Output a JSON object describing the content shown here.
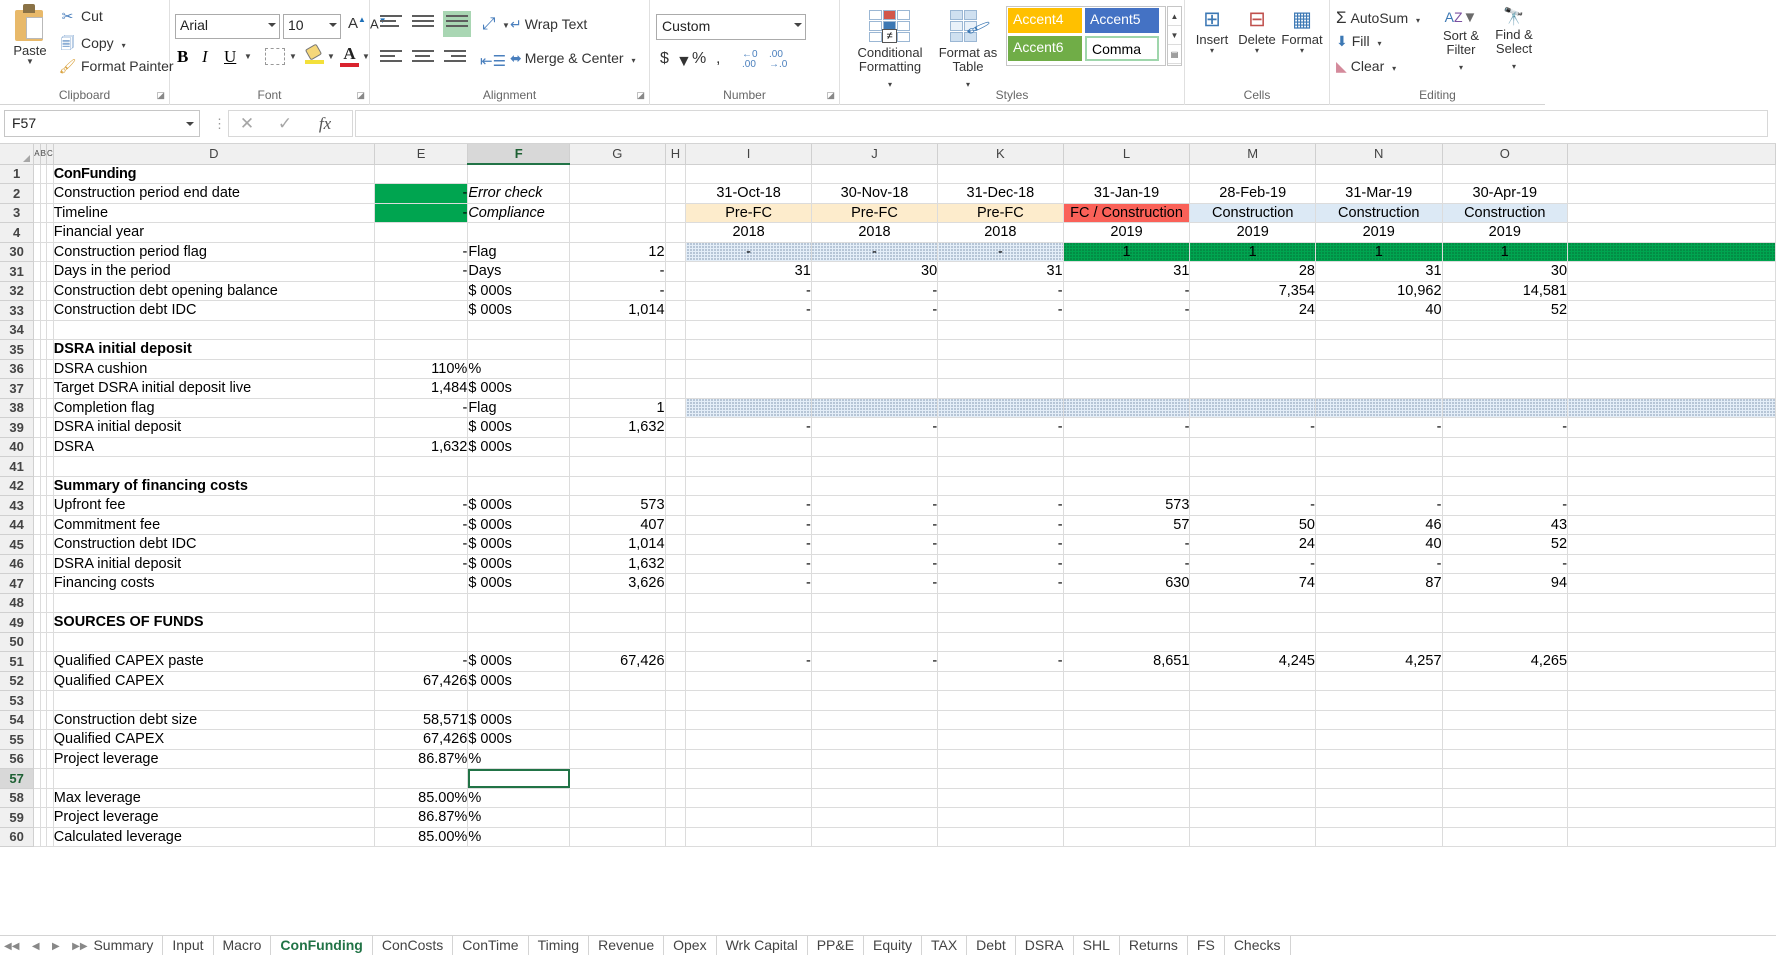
{
  "ribbon": {
    "clipboard": {
      "label": "Clipboard",
      "paste": "Paste",
      "cut": "Cut",
      "copy": "Copy",
      "format_painter": "Format Painter"
    },
    "font": {
      "label": "Font",
      "font_name": "Arial",
      "font_size": "10",
      "grow_font": "A",
      "shrink_font": "A",
      "bold": "B",
      "italic": "I",
      "underline": "U",
      "font_color_letter": "A"
    },
    "alignment": {
      "label": "Alignment",
      "wrap_text": "Wrap Text",
      "merge_center": "Merge & Center"
    },
    "number": {
      "label": "Number",
      "format": "Custom",
      "currency": "$",
      "percent": "%",
      "comma": ",",
      "inc_dec": ".00",
      "dec_dec": ".0"
    },
    "styles": {
      "label": "Styles",
      "conditional_formatting": "Conditional Formatting",
      "format_as_table": "Format as Table",
      "gallery": [
        {
          "name": "Accent4",
          "bg": "#ffc000",
          "fg": "#ffffff"
        },
        {
          "name": "Accent5",
          "bg": "#4472c4",
          "fg": "#ffffff"
        },
        {
          "name": "Accent6",
          "bg": "#70ad47",
          "fg": "#ffffff"
        },
        {
          "name": "Comma",
          "bg": "#ffffff",
          "fg": "#000000"
        }
      ]
    },
    "cells": {
      "label": "Cells",
      "insert": "Insert",
      "delete": "Delete",
      "format": "Format"
    },
    "editing": {
      "label": "Editing",
      "autosum": "AutoSum",
      "fill": "Fill",
      "clear": "Clear",
      "sort_filter": "Sort & Filter",
      "find_select": "Find & Select"
    }
  },
  "formula_bar": {
    "name_box": "F57",
    "cancel": "✕",
    "enter": "✓",
    "insert_function": "fx",
    "formula_value": ""
  },
  "grid": {
    "columns": [
      "D",
      "E",
      "F",
      "G",
      "H",
      "I",
      "J",
      "K",
      "L",
      "M",
      "N",
      "O"
    ],
    "active_column": "F",
    "active_row": "57",
    "selected_cell": "F57"
  },
  "sheet": {
    "rows": [
      {
        "n": "1",
        "D": "ConFunding",
        "E": "",
        "F": "",
        "G": "",
        "per": [
          "",
          "",
          "",
          "",
          "",
          "",
          ""
        ]
      },
      {
        "n": "2",
        "D": "Construction period end date",
        "E": "-",
        "F": "Error check",
        "G": "",
        "per": [
          "",
          "",
          "",
          "",
          "",
          "",
          ""
        ]
      },
      {
        "n": "3",
        "D": "Timeline",
        "E": "-",
        "F": "Compliance",
        "G": "",
        "per": [
          "Pre-FC",
          "Pre-FC",
          "Pre-FC",
          "FC / Construction",
          "Construction",
          "Construction",
          "Construction"
        ]
      },
      {
        "n": "4",
        "D": "Financial year",
        "E": "",
        "F": "",
        "G": "",
        "per": [
          "2018",
          "2018",
          "2018",
          "2019",
          "2019",
          "2019",
          "2019"
        ]
      },
      {
        "n": "30",
        "D": "Construction period flag",
        "E": "-",
        "F": "Flag",
        "G": "12",
        "per": [
          "-",
          "-",
          "-",
          "1",
          "1",
          "1",
          "1"
        ]
      },
      {
        "n": "31",
        "D": "Days in the period",
        "E": "-",
        "F": "Days",
        "G": "-",
        "per": [
          "31",
          "30",
          "31",
          "31",
          "28",
          "31",
          "30"
        ]
      },
      {
        "n": "32",
        "D": "Construction debt opening balance",
        "E": "",
        "F": "$ 000s",
        "G": "-",
        "per": [
          "-",
          "-",
          "-",
          "-",
          "7,354",
          "10,962",
          "14,581"
        ]
      },
      {
        "n": "33",
        "D": "Construction debt IDC",
        "E": "",
        "F": "$ 000s",
        "G": "1,014",
        "per": [
          "-",
          "-",
          "-",
          "-",
          "24",
          "40",
          "52"
        ]
      },
      {
        "n": "34",
        "D": "",
        "E": "",
        "F": "",
        "G": "",
        "per": [
          "",
          "",
          "",
          "",
          "",
          "",
          ""
        ]
      },
      {
        "n": "35",
        "D": "DSRA initial deposit",
        "E": "",
        "F": "",
        "G": "",
        "per": [
          "",
          "",
          "",
          "",
          "",
          "",
          ""
        ]
      },
      {
        "n": "36",
        "D": "DSRA cushion",
        "E": "110%",
        "F": "%",
        "G": "",
        "per": [
          "",
          "",
          "",
          "",
          "",
          "",
          ""
        ]
      },
      {
        "n": "37",
        "D": "Target DSRA initial deposit live",
        "E": "1,484",
        "F": "$ 000s",
        "G": "",
        "per": [
          "",
          "",
          "",
          "",
          "",
          "",
          ""
        ]
      },
      {
        "n": "38",
        "D": "Completion flag",
        "E": "-",
        "F": "Flag",
        "G": "1",
        "per": [
          "",
          "",
          "",
          "",
          "",
          "",
          ""
        ]
      },
      {
        "n": "39",
        "D": "DSRA initial deposit",
        "E": "",
        "F": "$ 000s",
        "G": "1,632",
        "per": [
          "-",
          "-",
          "-",
          "-",
          "-",
          "-",
          "-"
        ]
      },
      {
        "n": "40",
        "D": "DSRA",
        "E": "1,632",
        "F": "$ 000s",
        "G": "",
        "per": [
          "",
          "",
          "",
          "",
          "",
          "",
          ""
        ]
      },
      {
        "n": "41",
        "D": "",
        "E": "",
        "F": "",
        "G": "",
        "per": [
          "",
          "",
          "",
          "",
          "",
          "",
          ""
        ]
      },
      {
        "n": "42",
        "D": "Summary of financing costs",
        "E": "",
        "F": "",
        "G": "",
        "per": [
          "",
          "",
          "",
          "",
          "",
          "",
          ""
        ]
      },
      {
        "n": "43",
        "D": "Upfront fee",
        "E": "-",
        "F": "$ 000s",
        "G": "573",
        "per": [
          "-",
          "-",
          "-",
          "573",
          "-",
          "-",
          "-"
        ]
      },
      {
        "n": "44",
        "D": "Commitment fee",
        "E": "-",
        "F": "$ 000s",
        "G": "407",
        "per": [
          "-",
          "-",
          "-",
          "57",
          "50",
          "46",
          "43"
        ]
      },
      {
        "n": "45",
        "D": "Construction debt IDC",
        "E": "-",
        "F": "$ 000s",
        "G": "1,014",
        "per": [
          "-",
          "-",
          "-",
          "-",
          "24",
          "40",
          "52"
        ]
      },
      {
        "n": "46",
        "D": "DSRA initial deposit",
        "E": "-",
        "F": "$ 000s",
        "G": "1,632",
        "per": [
          "-",
          "-",
          "-",
          "-",
          "-",
          "-",
          "-"
        ]
      },
      {
        "n": "47",
        "D": "Financing costs",
        "E": "",
        "F": "$ 000s",
        "G": "3,626",
        "per": [
          "-",
          "-",
          "-",
          "630",
          "74",
          "87",
          "94"
        ]
      },
      {
        "n": "48",
        "D": "",
        "E": "",
        "F": "",
        "G": "",
        "per": [
          "",
          "",
          "",
          "",
          "",
          "",
          ""
        ]
      },
      {
        "n": "49",
        "D": "SOURCES OF FUNDS",
        "E": "",
        "F": "",
        "G": "",
        "per": [
          "",
          "",
          "",
          "",
          "",
          "",
          ""
        ]
      },
      {
        "n": "50",
        "D": "",
        "E": "",
        "F": "",
        "G": "",
        "per": [
          "",
          "",
          "",
          "",
          "",
          "",
          ""
        ]
      },
      {
        "n": "51",
        "D": "Qualified CAPEX paste",
        "E": "-",
        "F": "$ 000s",
        "G": "67,426",
        "per": [
          "-",
          "-",
          "-",
          "8,651",
          "4,245",
          "4,257",
          "4,265"
        ]
      },
      {
        "n": "52",
        "D": "Qualified CAPEX",
        "E": "67,426",
        "F": "$ 000s",
        "G": "",
        "per": [
          "",
          "",
          "",
          "",
          "",
          "",
          ""
        ]
      },
      {
        "n": "53",
        "D": "",
        "E": "",
        "F": "",
        "G": "",
        "per": [
          "",
          "",
          "",
          "",
          "",
          "",
          ""
        ]
      },
      {
        "n": "54",
        "D": "Construction debt size",
        "E": "58,571",
        "F": "$ 000s",
        "G": "",
        "per": [
          "",
          "",
          "",
          "",
          "",
          "",
          ""
        ]
      },
      {
        "n": "55",
        "D": "Qualified CAPEX",
        "E": "67,426",
        "F": "$ 000s",
        "G": "",
        "per": [
          "",
          "",
          "",
          "",
          "",
          "",
          ""
        ]
      },
      {
        "n": "56",
        "D": "Project leverage",
        "E": "86.87%",
        "F": "%",
        "G": "",
        "per": [
          "",
          "",
          "",
          "",
          "",
          "",
          ""
        ]
      },
      {
        "n": "57",
        "D": "",
        "E": "",
        "F": "",
        "G": "",
        "per": [
          "",
          "",
          "",
          "",
          "",
          "",
          ""
        ]
      },
      {
        "n": "58",
        "D": "Max leverage",
        "E": "85.00%",
        "F": "%",
        "G": "",
        "per": [
          "",
          "",
          "",
          "",
          "",
          "",
          ""
        ]
      },
      {
        "n": "59",
        "D": "Project leverage",
        "E": "86.87%",
        "F": "%",
        "G": "",
        "per": [
          "",
          "",
          "",
          "",
          "",
          "",
          ""
        ]
      },
      {
        "n": "60",
        "D": "Calculated leverage",
        "E": "85.00%",
        "F": "%",
        "G": "",
        "per": [
          "",
          "",
          "",
          "",
          "",
          "",
          ""
        ]
      }
    ],
    "period_dates": [
      "31-Oct-18",
      "30-Nov-18",
      "31-Dec-18",
      "31-Jan-19",
      "28-Feb-19",
      "31-Mar-19",
      "30-Apr-19"
    ]
  },
  "sheet_tabs": [
    {
      "name": "Summary",
      "active": false
    },
    {
      "name": "Input",
      "active": false
    },
    {
      "name": "Macro",
      "active": false
    },
    {
      "name": "ConFunding",
      "active": true
    },
    {
      "name": "ConCosts",
      "active": false
    },
    {
      "name": "ConTime",
      "active": false
    },
    {
      "name": "Timing",
      "active": false
    },
    {
      "name": "Revenue",
      "active": false
    },
    {
      "name": "Opex",
      "active": false
    },
    {
      "name": "Wrk Capital",
      "active": false
    },
    {
      "name": "PP&E",
      "active": false
    },
    {
      "name": "Equity",
      "active": false
    },
    {
      "name": "TAX",
      "active": false
    },
    {
      "name": "Debt",
      "active": false
    },
    {
      "name": "DSRA",
      "active": false
    },
    {
      "name": "SHL",
      "active": false
    },
    {
      "name": "Returns",
      "active": false
    },
    {
      "name": "FS",
      "active": false
    },
    {
      "name": "Checks",
      "active": false
    }
  ]
}
